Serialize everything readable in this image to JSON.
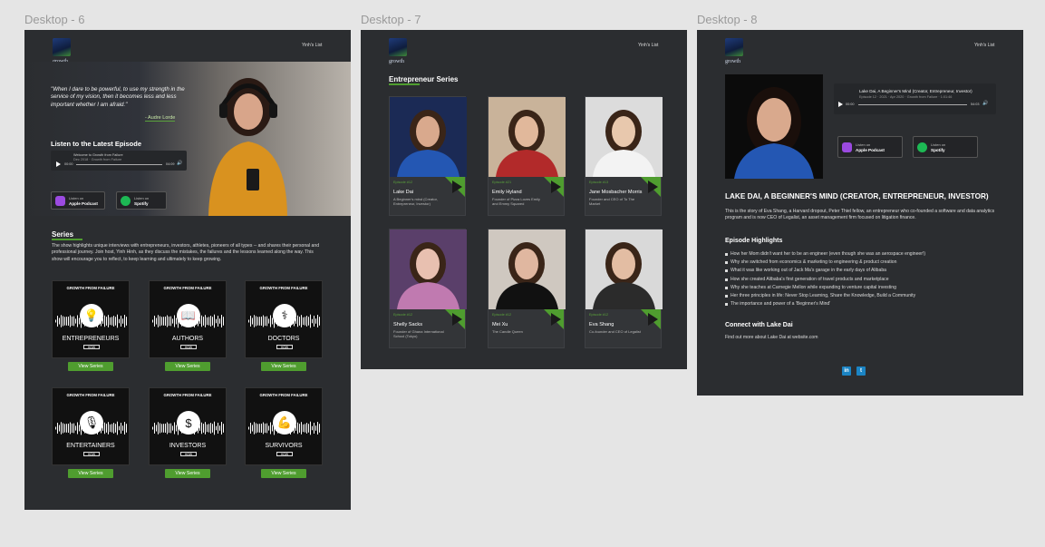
{
  "frames": {
    "f6": "Desktop - 6",
    "f7": "Desktop - 7",
    "f8": "Desktop - 8"
  },
  "logo": {
    "text": "growth"
  },
  "nav": {
    "yinhs_list": "Yinh's List"
  },
  "d6": {
    "quote": "\"When I dare to be powerful, to use my strength in the service of my vision, then it becomes less and less important whether I am afraid.\"",
    "quote_author": "- Audre Lorde",
    "listen_heading": "Listen to the Latest Episode",
    "player": {
      "title": "Welcome to Growth from Failure",
      "meta": "Dec 2018 · Growth from Failure",
      "time_start": "00:00",
      "time_end": "04:09"
    },
    "badges": {
      "apple_small": "Listen on",
      "apple_big": "Apple Podcast",
      "spotify_small": "Listen on",
      "spotify_big": "Spotify"
    },
    "series_title": "Series",
    "series_desc": "The show highlights unique interviews with entrepreneurs, investors, athletes, pioneers of all types -- and shares their personal and professional journey. Join host, Yinh Hinh, as they discuss the mistakes, the failures and the lessons learned along the way. This show will encourage you to reflect, to keep learning and ultimately to keep growing.",
    "tile_top": "GROWTH FROM FAILURE",
    "tile_how": "HOW",
    "tiles": [
      {
        "cat": "ENTREPRENEURS",
        "icon": "lightbulb-icon",
        "glyph": "💡"
      },
      {
        "cat": "AUTHORS",
        "icon": "book-icon",
        "glyph": "📖"
      },
      {
        "cat": "DOCTORS",
        "icon": "stethoscope-icon",
        "glyph": "⚕"
      },
      {
        "cat": "ENTERTAINERS",
        "icon": "microphone-icon",
        "glyph": "🎙"
      },
      {
        "cat": "INVESTORS",
        "icon": "money-chart-icon",
        "glyph": "$"
      },
      {
        "cat": "SURVIVORS",
        "icon": "flexed-arm-icon",
        "glyph": "💪"
      }
    ],
    "view_series": "View Series"
  },
  "d7": {
    "title": "Entrepreneur Series",
    "cards": [
      {
        "ep": "Episode #12",
        "name": "Lake Dai",
        "desc": "A Beginner's mind (Creator, Entrepreneur, Investor)"
      },
      {
        "ep": "Episode #21",
        "name": "Emily Hyland",
        "desc": "Founder of Pizza Loves Emily and Emmy Squared"
      },
      {
        "ep": "Episode #13",
        "name": "Jane Mosbacher Morris",
        "desc": "Founder and CEO of To The Market"
      },
      {
        "ep": "Episode #12",
        "name": "Shelly Sacks",
        "desc": "Founder of Ghana International School (Tokyo)"
      },
      {
        "ep": "Episode #12",
        "name": "Mei Xu",
        "desc": "The Candle Queen"
      },
      {
        "ep": "Episode #12",
        "name": "Eva Shang",
        "desc": "Co-founder and CEO of Legalist"
      }
    ]
  },
  "d8": {
    "player_title": "Lake Dai, A Beginner's Mind (Creator, Entrepreneur, Investor)",
    "player_meta": "Episode 12 · 2021 · Apr 2020 · Growth from Failure · 1:01:46",
    "player_start": "00:00",
    "player_end": "54:03",
    "heading": "LAKE DAI, A BEGINNER'S MIND (CREATOR, ENTREPRENEUR, INVESTOR)",
    "story": "This is the story of Eva Shang, a Harvard dropout, Peter Thiel fellow, an entrepreneur who co-founded a software and data analytics program and is now CEO of Legalist, an asset management firm focused on litigation finance.",
    "highlights_title": "Episode Highlights",
    "highlights": [
      "How her Mom didn't want her to be an engineer (even though she was an aerospace engineer!)",
      "Why she switched from economics & marketing to engineering & product creation",
      "What it was like working out of Jack Ma's garage in the early days of Alibaba",
      "How she created Alibaba's first generation of travel products and marketplace",
      "Why she teaches at Carnegie Mellon while expanding to venture capital investing",
      "Her three principles in life: Never Stop Learning, Share the Knowledge, Build a Community",
      "The importance and power of a 'Beginner's Mind'"
    ],
    "connect_title": "Connect with Lake Dai",
    "connect_text": "Find out more about Lake Dai at website.com",
    "linkedin": "in",
    "twitter": "t"
  },
  "colors": {
    "accent": "#4f9d2f",
    "frame_bg": "#2b2d30",
    "canvas": "#e5e5e5"
  }
}
